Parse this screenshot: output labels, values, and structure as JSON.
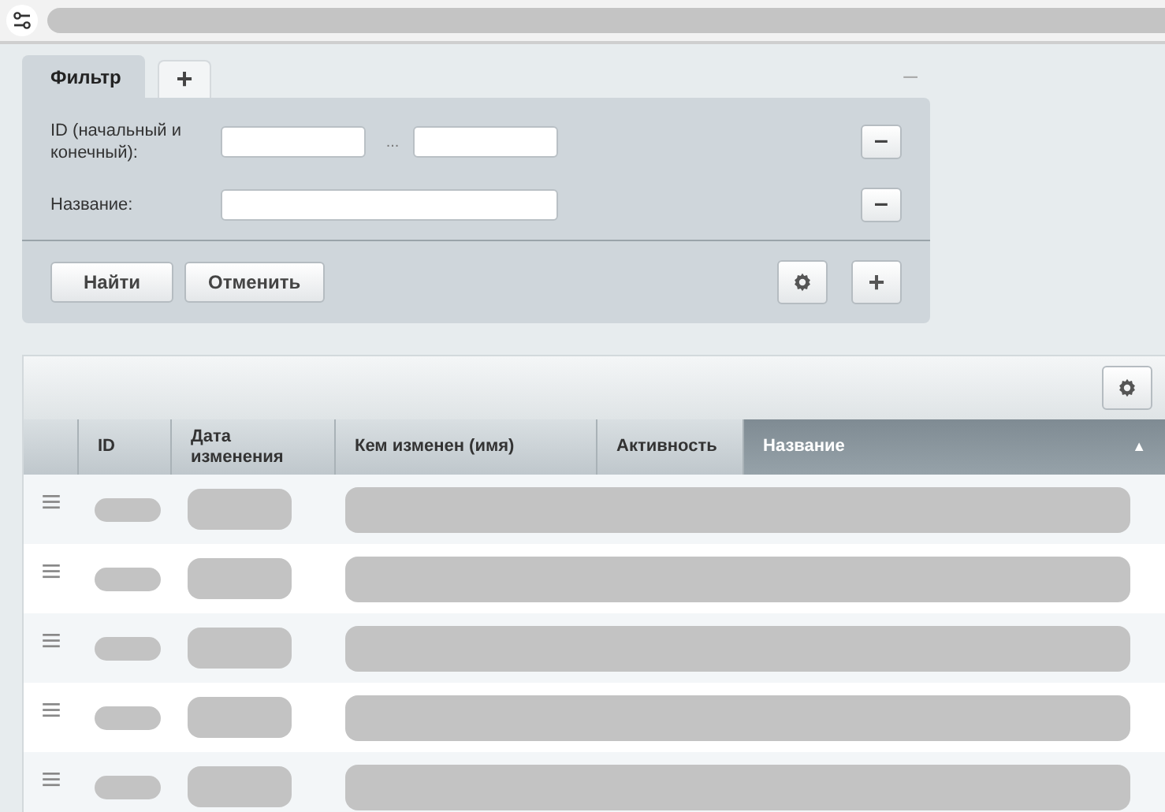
{
  "filter": {
    "tabs": [
      {
        "label": "Фильтр",
        "selected": true
      },
      {
        "label": "+",
        "selected": false
      }
    ],
    "collapse": "–",
    "fields": [
      {
        "label": "ID (начальный и конечный):",
        "kind": "range",
        "separator": "...",
        "remove": "–"
      },
      {
        "label": "Название:",
        "kind": "text",
        "remove": "–"
      }
    ],
    "buttons": [
      "Найти",
      "Отменить"
    ],
    "add": "+"
  },
  "table": {
    "columns": [
      {
        "selected": false
      },
      {
        "label": "ID",
        "selected": false
      },
      {
        "label": "Дата изменения",
        "selected": false
      },
      {
        "label": "Кем изменен (имя)",
        "selected": false
      },
      {
        "label": "Активность",
        "selected": false
      },
      {
        "label": "Название",
        "selected": true,
        "sort": "▲"
      }
    ],
    "rows": [
      {
        "kind": "redacted"
      },
      {
        "kind": "redacted"
      },
      {
        "kind": "redacted"
      },
      {
        "kind": "redacted"
      },
      {
        "kind": "redacted"
      }
    ]
  }
}
